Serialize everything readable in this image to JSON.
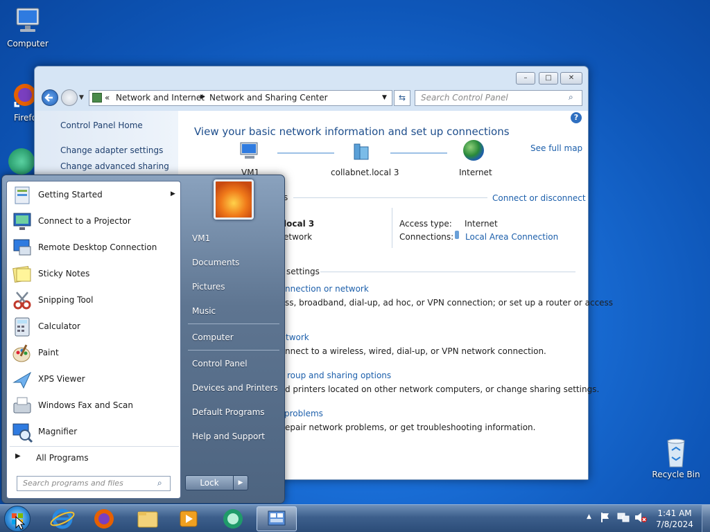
{
  "desktop": {
    "icons": [
      {
        "label": "Computer"
      },
      {
        "label": "Firefo"
      },
      {
        "label": "Recycle Bin"
      }
    ]
  },
  "window": {
    "min": "–",
    "max": "□",
    "close": "✕",
    "breadcrumb": {
      "prefix": "«",
      "part1": "Network and Internet",
      "part2": "Network and Sharing Center"
    },
    "search_placeholder": "Search Control Panel",
    "left_links": [
      "Control Panel Home",
      "Change adapter settings",
      "Change advanced sharing"
    ],
    "heading": "View your basic network information and set up connections",
    "see_full_map": "See full map",
    "map": {
      "node1": "VM1",
      "node2": "collabnet.local  3",
      "node3": "Internet"
    },
    "active_networks_tail": "s",
    "connect_disconnect": "Connect or disconnect",
    "network_name": "local  3",
    "network_type": "etwork",
    "access_type_label": "Access type:",
    "access_type_value": "Internet",
    "connections_label": "Connections:",
    "connections_value": "Local Area Connection",
    "change_settings_tail": "settings",
    "tasks": [
      {
        "link": "nnection or network",
        "desc": "ss, broadband, dial-up, ad hoc, or VPN connection; or set up a router or access"
      },
      {
        "link": "twork",
        "desc": "nnect to a wireless, wired, dial-up, or VPN network connection."
      },
      {
        "link": "roup and sharing options",
        "desc": "d printers located on other network computers, or change sharing settings."
      },
      {
        "link": "problems",
        "desc": "epair network problems, or get troubleshooting information."
      }
    ]
  },
  "start_menu": {
    "programs": [
      {
        "label": "Getting Started",
        "icon": "getting-started-icon"
      },
      {
        "label": "Connect to a Projector",
        "icon": "projector-icon"
      },
      {
        "label": "Remote Desktop Connection",
        "icon": "remote-desktop-icon"
      },
      {
        "label": "Sticky Notes",
        "icon": "sticky-notes-icon"
      },
      {
        "label": "Snipping Tool",
        "icon": "snipping-tool-icon"
      },
      {
        "label": "Calculator",
        "icon": "calculator-icon"
      },
      {
        "label": "Paint",
        "icon": "paint-icon"
      },
      {
        "label": "XPS Viewer",
        "icon": "xps-viewer-icon"
      },
      {
        "label": "Windows Fax and Scan",
        "icon": "fax-scan-icon"
      },
      {
        "label": "Magnifier",
        "icon": "magnifier-icon"
      }
    ],
    "all_programs": "All Programs",
    "search_placeholder": "Search programs and files",
    "right": [
      "VM1",
      "Documents",
      "Pictures",
      "Music",
      "Computer",
      "Control Panel",
      "Devices and Printers",
      "Default Programs",
      "Help and Support"
    ],
    "lock": "Lock"
  },
  "taskbar": {
    "time": "1:41 AM",
    "date": "7/8/2024"
  }
}
